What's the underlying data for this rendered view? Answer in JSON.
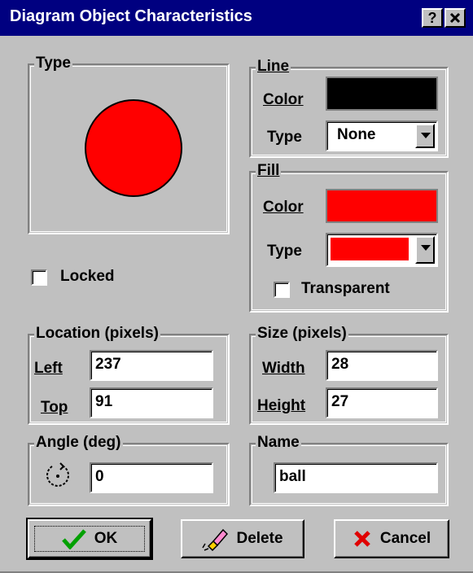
{
  "window": {
    "title": "Diagram Object Characteristics",
    "help_label": "?",
    "close_label": "✕"
  },
  "type_group": {
    "legend": "Type",
    "shape": "circle",
    "fill_color": "#ff0000"
  },
  "locked": {
    "label": "Locked",
    "checked": false
  },
  "line_group": {
    "legend": "Line",
    "color_label": "Color",
    "color_value": "#000000",
    "type_label": "Type",
    "type_value": "None"
  },
  "fill_group": {
    "legend": "Fill",
    "color_label": "Color",
    "color_value": "#ff0000",
    "type_label": "Type",
    "type_value_color": "#ff0000",
    "transparent_label": "Transparent",
    "transparent_checked": false
  },
  "location_group": {
    "legend": "Location (pixels)",
    "left_label": "Left",
    "left_value": "237",
    "top_label": "Top",
    "top_value": "91"
  },
  "size_group": {
    "legend": "Size (pixels)",
    "width_label": "Width",
    "width_value": "28",
    "height_label": "Height",
    "height_value": "27"
  },
  "angle_group": {
    "legend": "Angle (deg)",
    "angle_icon": "rotate-icon",
    "angle_value": "0"
  },
  "name_group": {
    "legend": "Name",
    "name_value": "ball"
  },
  "buttons": {
    "ok": "OK",
    "delete": "Delete",
    "cancel": "Cancel"
  }
}
